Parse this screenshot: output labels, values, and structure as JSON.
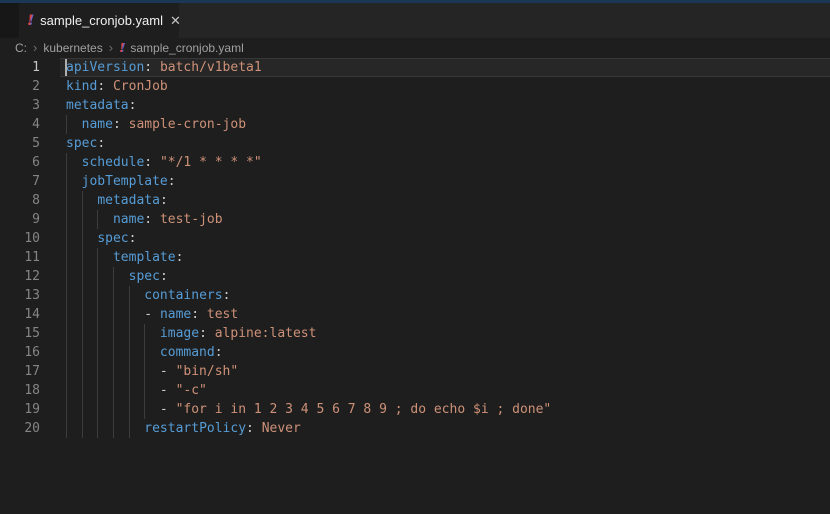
{
  "colors": {
    "accent_strip": "#1a3756",
    "tab_bar_bg": "#252526",
    "tab_active_bg": "#1e1e1e",
    "sliver_bg": "#171718",
    "tab_fg": "#f0f0f0",
    "editor_bg": "#1e1e1e",
    "breadcrumb_fg": "#a0a0a0",
    "breadcrumb_sep": "#6e6e6e",
    "line_number": "#858585",
    "line_number_active": "#c6c6c6",
    "indent_guide": "#3d3d3d",
    "key": "#569cd6",
    "string": "#ce9178",
    "punct": "#cccccc",
    "cursor": "#aeafad",
    "yaml_icon_red": "#d8454f",
    "yaml_icon_purple": "#6e66cc"
  },
  "icons": {
    "yaml_glyph": "!",
    "close_glyph": "✕",
    "chevron_glyph": "›"
  },
  "tab_bar": {
    "tabs": [
      {
        "label": "sample_cronjob.yaml",
        "active": true
      }
    ]
  },
  "breadcrumb": {
    "items": [
      "C:",
      "kubernetes",
      "sample_cronjob.yaml"
    ]
  },
  "editor": {
    "language": "yaml",
    "cursor": {
      "line": 1,
      "col": 0
    },
    "lines": [
      {
        "num": 1,
        "indent": 0,
        "active": true,
        "tokens": [
          {
            "t": "key",
            "text": "apiVersion"
          },
          {
            "t": "punct",
            "text": ": "
          },
          {
            "t": "str",
            "text": "batch/v1beta1"
          }
        ]
      },
      {
        "num": 2,
        "indent": 0,
        "tokens": [
          {
            "t": "key",
            "text": "kind"
          },
          {
            "t": "punct",
            "text": ": "
          },
          {
            "t": "str",
            "text": "CronJob"
          }
        ]
      },
      {
        "num": 3,
        "indent": 0,
        "tokens": [
          {
            "t": "key",
            "text": "metadata"
          },
          {
            "t": "punct",
            "text": ":"
          }
        ]
      },
      {
        "num": 4,
        "indent": 2,
        "tokens": [
          {
            "t": "key",
            "text": "name"
          },
          {
            "t": "punct",
            "text": ": "
          },
          {
            "t": "str",
            "text": "sample-cron-job"
          }
        ]
      },
      {
        "num": 5,
        "indent": 0,
        "tokens": [
          {
            "t": "key",
            "text": "spec"
          },
          {
            "t": "punct",
            "text": ":"
          }
        ]
      },
      {
        "num": 6,
        "indent": 2,
        "tokens": [
          {
            "t": "key",
            "text": "schedule"
          },
          {
            "t": "punct",
            "text": ": "
          },
          {
            "t": "str",
            "text": "\"*/1 * * * *\""
          }
        ]
      },
      {
        "num": 7,
        "indent": 2,
        "tokens": [
          {
            "t": "key",
            "text": "jobTemplate"
          },
          {
            "t": "punct",
            "text": ":"
          }
        ]
      },
      {
        "num": 8,
        "indent": 4,
        "tokens": [
          {
            "t": "key",
            "text": "metadata"
          },
          {
            "t": "punct",
            "text": ":"
          }
        ]
      },
      {
        "num": 9,
        "indent": 6,
        "tokens": [
          {
            "t": "key",
            "text": "name"
          },
          {
            "t": "punct",
            "text": ": "
          },
          {
            "t": "str",
            "text": "test-job"
          }
        ]
      },
      {
        "num": 10,
        "indent": 4,
        "tokens": [
          {
            "t": "key",
            "text": "spec"
          },
          {
            "t": "punct",
            "text": ":"
          }
        ]
      },
      {
        "num": 11,
        "indent": 6,
        "tokens": [
          {
            "t": "key",
            "text": "template"
          },
          {
            "t": "punct",
            "text": ":"
          }
        ]
      },
      {
        "num": 12,
        "indent": 8,
        "tokens": [
          {
            "t": "key",
            "text": "spec"
          },
          {
            "t": "punct",
            "text": ":"
          }
        ]
      },
      {
        "num": 13,
        "indent": 10,
        "tokens": [
          {
            "t": "key",
            "text": "containers"
          },
          {
            "t": "punct",
            "text": ":"
          }
        ]
      },
      {
        "num": 14,
        "indent": 10,
        "tokens": [
          {
            "t": "punct",
            "text": "- "
          },
          {
            "t": "key",
            "text": "name"
          },
          {
            "t": "punct",
            "text": ": "
          },
          {
            "t": "str",
            "text": "test"
          }
        ]
      },
      {
        "num": 15,
        "indent": 12,
        "tokens": [
          {
            "t": "key",
            "text": "image"
          },
          {
            "t": "punct",
            "text": ": "
          },
          {
            "t": "str",
            "text": "alpine:latest"
          }
        ]
      },
      {
        "num": 16,
        "indent": 12,
        "tokens": [
          {
            "t": "key",
            "text": "command"
          },
          {
            "t": "punct",
            "text": ":"
          }
        ]
      },
      {
        "num": 17,
        "indent": 12,
        "tokens": [
          {
            "t": "punct",
            "text": "- "
          },
          {
            "t": "str",
            "text": "\"bin/sh\""
          }
        ]
      },
      {
        "num": 18,
        "indent": 12,
        "tokens": [
          {
            "t": "punct",
            "text": "- "
          },
          {
            "t": "str",
            "text": "\"-c\""
          }
        ]
      },
      {
        "num": 19,
        "indent": 12,
        "tokens": [
          {
            "t": "punct",
            "text": "- "
          },
          {
            "t": "str",
            "text": "\"for i in 1 2 3 4 5 6 7 8 9 ; do echo $i ; done\""
          }
        ]
      },
      {
        "num": 20,
        "indent": 10,
        "tokens": [
          {
            "t": "key",
            "text": "restartPolicy"
          },
          {
            "t": "punct",
            "text": ": "
          },
          {
            "t": "str",
            "text": "Never"
          }
        ]
      }
    ]
  }
}
